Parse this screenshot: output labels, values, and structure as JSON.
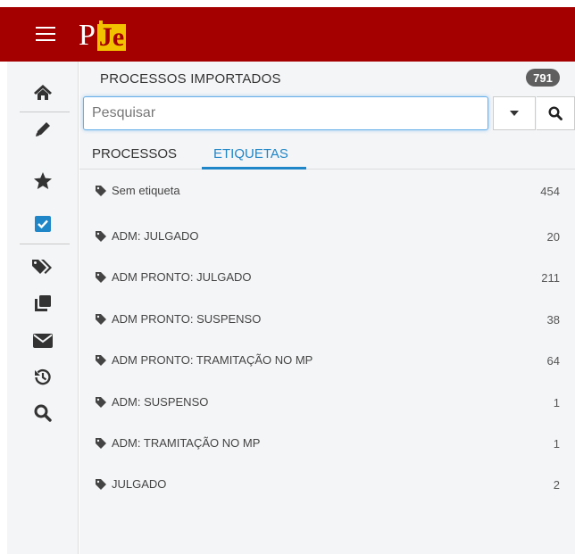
{
  "header": {
    "logo_p": "P",
    "logo_je": "Je",
    "brand_color": "#a50000",
    "logo_accent": "#f2c200"
  },
  "rail": {
    "items": [
      {
        "name": "home-icon"
      },
      {
        "name": "pencil-icon"
      },
      {
        "name": "star-icon"
      },
      {
        "name": "checkbox-icon"
      },
      {
        "name": "tags-icon"
      },
      {
        "name": "copy-icon"
      },
      {
        "name": "envelope-icon"
      },
      {
        "name": "history-icon"
      },
      {
        "name": "search-icon"
      }
    ]
  },
  "panel": {
    "title": "PROCESSOS IMPORTADOS",
    "count": "791",
    "search": {
      "placeholder": "Pesquisar",
      "value": ""
    },
    "tabs": [
      {
        "label": "PROCESSOS",
        "active": false
      },
      {
        "label": "ETIQUETAS",
        "active": true
      }
    ],
    "accent_color": "#1f86c7",
    "labels": [
      {
        "label": "Sem etiqueta",
        "count": "454"
      },
      {
        "label": "ADM: JULGADO",
        "count": "20"
      },
      {
        "label": "ADM PRONTO: JULGADO",
        "count": "211"
      },
      {
        "label": "ADM PRONTO: SUSPENSO",
        "count": "38"
      },
      {
        "label": "ADM PRONTO: TRAMITAÇÃO NO MP",
        "count": "64"
      },
      {
        "label": "ADM: SUSPENSO",
        "count": "1"
      },
      {
        "label": "ADM: TRAMITAÇÃO NO MP",
        "count": "1"
      },
      {
        "label": "JULGADO",
        "count": "2"
      }
    ]
  }
}
